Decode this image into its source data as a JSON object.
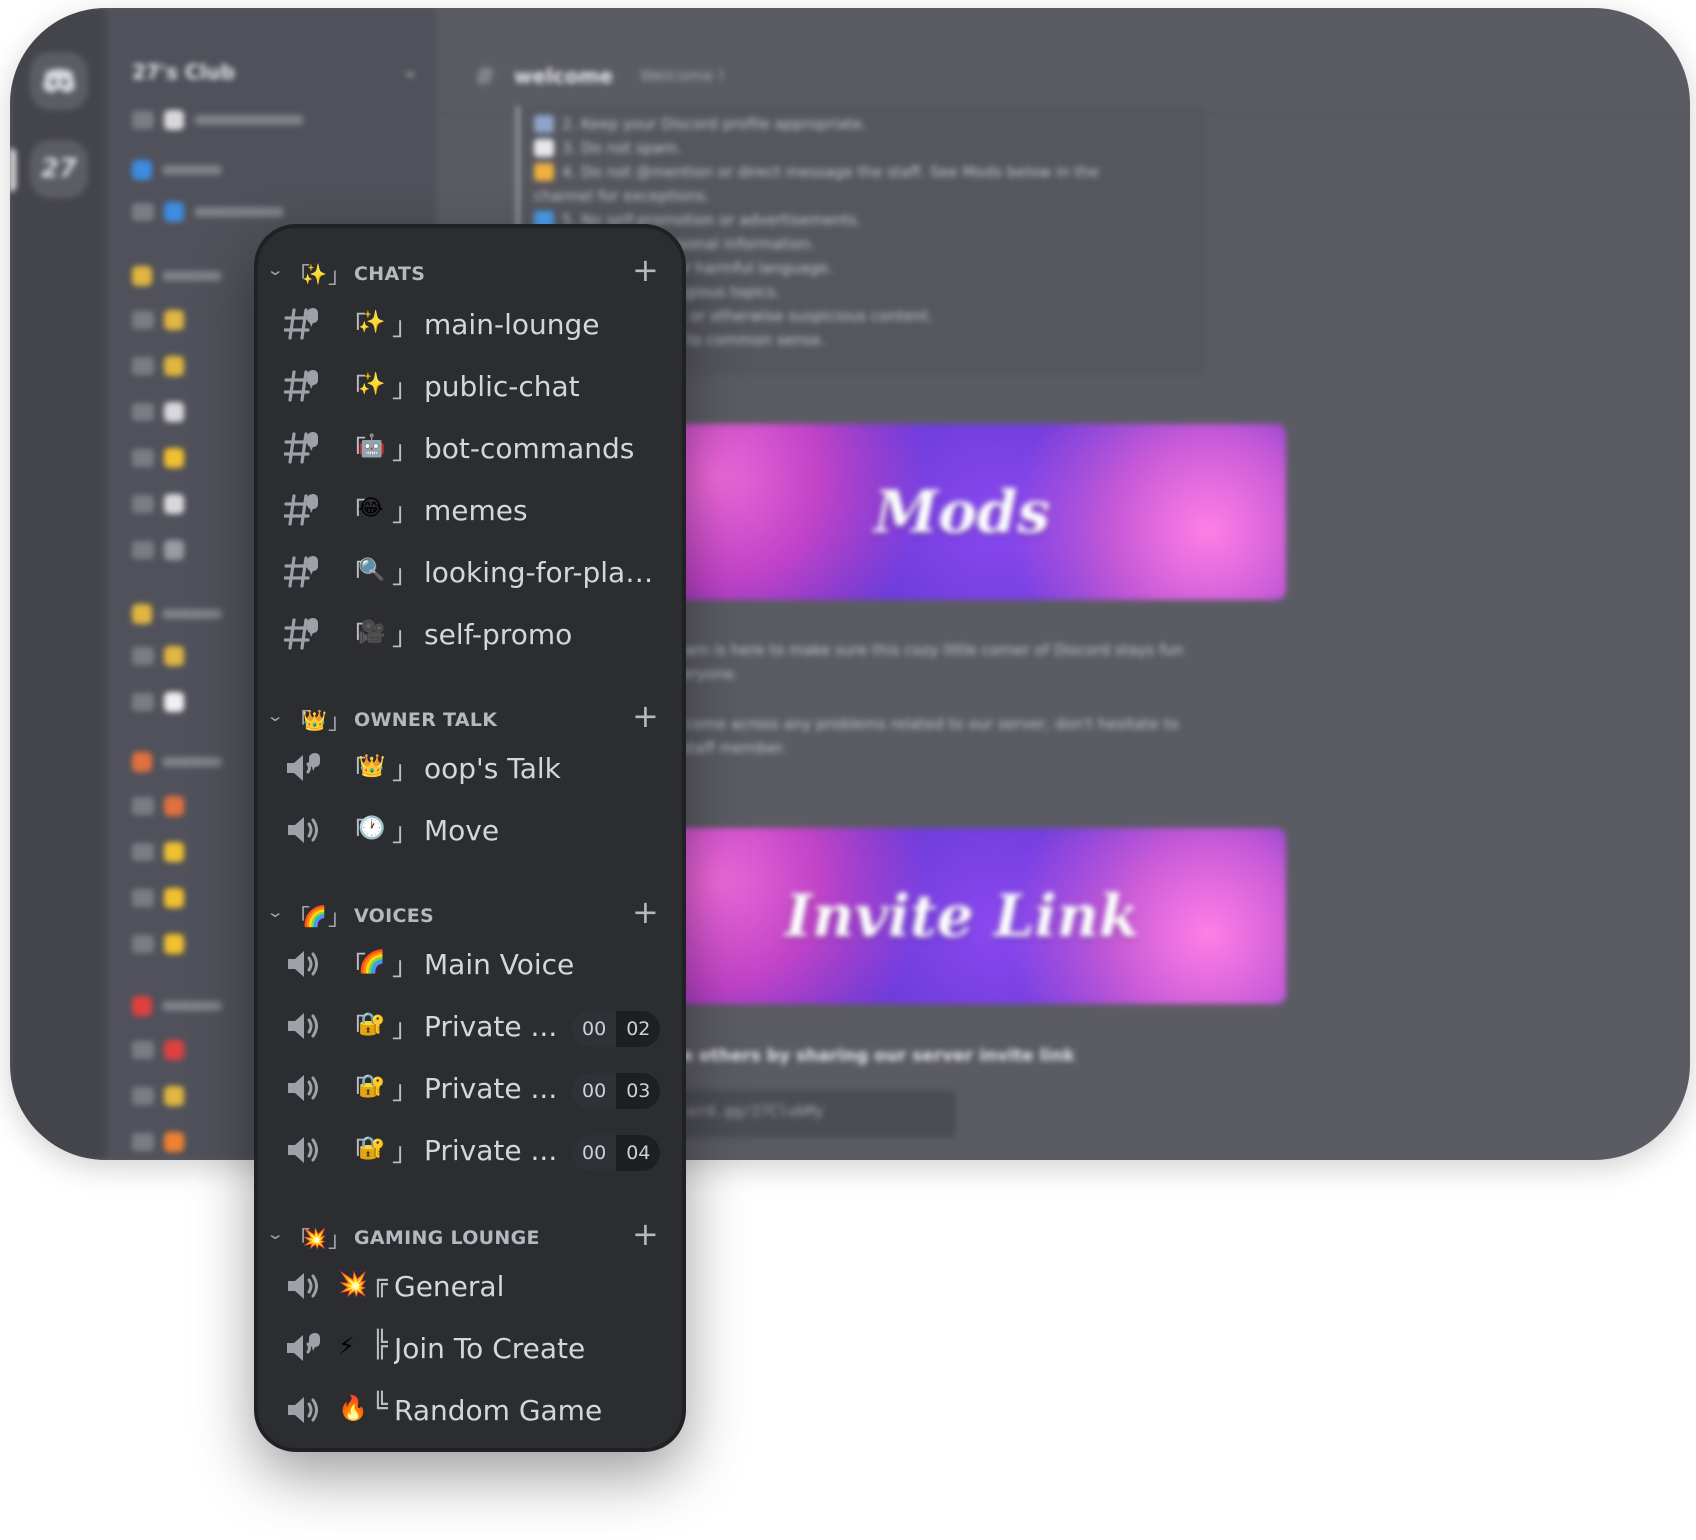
{
  "window": {
    "ad_label": "",
    "server_name": "27's Club",
    "channel_name": "welcome",
    "channel_topic": "Welcome !",
    "rules": [
      "2. Keep your Discord profile appropriate.",
      "3. Do not spam.",
      "4. Do not @mention or direct message the staff. See Mods below in the",
      "channel for exceptions.",
      "5. No self-promotion or advertisements.",
      "6. Do not share personal information.",
      "7. No hate speech or harmful language.",
      "8. No political or religious topics.",
      "9. No sexual, NSFW, or otherwise suspicious content.",
      "10. All rules subject to common sense."
    ],
    "banner_mods": "Mods",
    "para1": "Our team is here to make sure this cozy little corner of Discord stays fun for everyone.",
    "para2": "If you come across any problems related to our server, don't hesitate to tag a staff member.",
    "banner_invite": "Invite Link",
    "invite_heading": "Invite others by sharing our server invite link",
    "invite_code": "discord.gg/27ClubMy"
  },
  "panel": {
    "categories": [
      {
        "emoji": "✨",
        "label": "CHATS"
      },
      {
        "emoji": "👑",
        "label": "OWNER TALK"
      },
      {
        "emoji": "🌈",
        "label": "VOICES"
      },
      {
        "emoji": "💥",
        "label": "GAMING LOUNGE"
      }
    ],
    "chats": [
      {
        "emoji": "✨",
        "name": "main-lounge"
      },
      {
        "emoji": "✨",
        "name": "public-chat"
      },
      {
        "emoji": "🤖",
        "name": "bot-commands"
      },
      {
        "emoji": "😂",
        "name": "memes"
      },
      {
        "emoji": "🔍",
        "name": "looking-for-play..."
      },
      {
        "emoji": "🎥",
        "name": "self-promo"
      }
    ],
    "owner": [
      {
        "emoji": "👑",
        "name": "oop's Talk"
      },
      {
        "emoji": "🕐",
        "name": "Move"
      }
    ],
    "voices": [
      {
        "emoji": "🌈",
        "name": "Main Voice"
      },
      {
        "emoji": "🔐",
        "name": "Private ...",
        "count": "00",
        "limit": "02"
      },
      {
        "emoji": "🔐",
        "name": "Private ...",
        "count": "00",
        "limit": "03"
      },
      {
        "emoji": "🔐",
        "name": "Private ...",
        "count": "00",
        "limit": "04"
      }
    ],
    "gaming": [
      {
        "emoji": "💥",
        "tree": "╔",
        "name": "General"
      },
      {
        "emoji": "⚡",
        "tree": "╠",
        "name": "Join To Create"
      },
      {
        "emoji": "🔥",
        "tree": "╚",
        "name": "Random Game"
      }
    ],
    "bracket_left": "「",
    "bracket_right": "」",
    "plus": "+",
    "chevron": "⌄"
  }
}
